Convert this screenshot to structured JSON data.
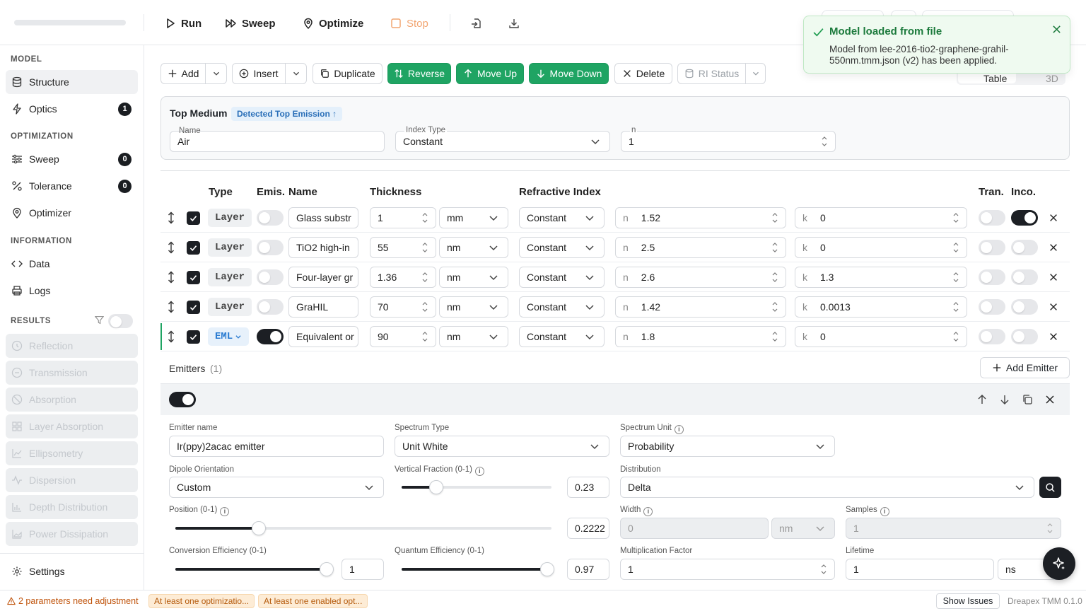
{
  "toolbar": {
    "run_label": "Run",
    "sweep_label": "Sweep",
    "optimize_label": "Optimize",
    "stop_label": "Stop"
  },
  "sidebar": {
    "model_section": "MODEL",
    "structure": "Structure",
    "optics": "Optics",
    "optics_badge": "1",
    "optimization_section": "OPTIMIZATION",
    "sweep": "Sweep",
    "sweep_badge": "0",
    "tolerance": "Tolerance",
    "tolerance_badge": "0",
    "optimizer": "Optimizer",
    "information_section": "INFORMATION",
    "data": "Data",
    "logs": "Logs",
    "results_section": "RESULTS",
    "results": [
      "Reflection",
      "Transmission",
      "Absorption",
      "Layer Absorption",
      "Ellipsometry",
      "Dispersion",
      "Depth Distribution",
      "Power Dissipation"
    ],
    "settings": "Settings"
  },
  "actions": {
    "add": "Add",
    "insert": "Insert",
    "duplicate": "Duplicate",
    "reverse": "Reverse",
    "move_up": "Move Up",
    "move_down": "Move Down",
    "delete": "Delete",
    "ri_status": "RI Status"
  },
  "view_tabs": {
    "table": "Table",
    "three_d": "3D"
  },
  "top_medium": {
    "title": "Top Medium",
    "badge": "Detected Top Emission ↑",
    "name_label": "Name",
    "name_value": "Air",
    "index_type_label": "Index Type",
    "index_type_value": "Constant",
    "n_label": "n",
    "n_value": "1"
  },
  "table": {
    "headers": {
      "type": "Type",
      "emis": "Emis.",
      "name": "Name",
      "thickness": "Thickness",
      "ri": "Refractive Index",
      "tran": "Tran.",
      "inco": "Inco."
    },
    "rows": [
      {
        "type": "Layer",
        "emissive": false,
        "name": "Glass substr",
        "thickness": "1",
        "unit": "mm",
        "index_type": "Constant",
        "n": "1.52",
        "k": "0",
        "tran": false,
        "inco": true
      },
      {
        "type": "Layer",
        "emissive": false,
        "name": "TiO2 high-in",
        "thickness": "55",
        "unit": "nm",
        "index_type": "Constant",
        "n": "2.5",
        "k": "0",
        "tran": false,
        "inco": false
      },
      {
        "type": "Layer",
        "emissive": false,
        "name": "Four-layer gr",
        "thickness": "1.36",
        "unit": "nm",
        "index_type": "Constant",
        "n": "2.6",
        "k": "1.3",
        "tran": false,
        "inco": false
      },
      {
        "type": "Layer",
        "emissive": false,
        "name": "GraHIL",
        "thickness": "70",
        "unit": "nm",
        "index_type": "Constant",
        "n": "1.42",
        "k": "0.0013",
        "tran": false,
        "inco": false
      },
      {
        "type": "EML",
        "emissive": true,
        "name": "Equivalent or",
        "thickness": "90",
        "unit": "nm",
        "index_type": "Constant",
        "n": "1.8",
        "k": "0",
        "tran": false,
        "inco": false
      }
    ],
    "n_prefix": "n",
    "k_prefix": "k"
  },
  "emitters": {
    "title": "Emitters",
    "count": "(1)",
    "add_label": "Add Emitter",
    "enabled": true,
    "name_label": "Emitter name",
    "name_value": "Ir(ppy)2acac emitter",
    "spectrum_type_label": "Spectrum Type",
    "spectrum_type_value": "Unit White",
    "spectrum_unit_label": "Spectrum Unit",
    "spectrum_unit_value": "Probability",
    "dipole_label": "Dipole Orientation",
    "dipole_value": "Custom",
    "vertical_label": "Vertical Fraction (0-1)",
    "vertical_value": "0.23",
    "vertical_fraction": 0.23,
    "distribution_label": "Distribution",
    "distribution_value": "Delta",
    "position_label": "Position (0-1)",
    "position_value": "0.2222",
    "position_fraction": 0.2222,
    "width_label": "Width",
    "width_value": "0",
    "width_unit": "nm",
    "samples_label": "Samples",
    "samples_value": "1",
    "conversion_label": "Conversion Efficiency (0-1)",
    "conversion_value": "1",
    "conversion_fraction": 1,
    "quantum_label": "Quantum Efficiency (0-1)",
    "quantum_value": "0.97",
    "quantum_fraction": 0.97,
    "multiplication_label": "Multiplication Factor",
    "multiplication_value": "1",
    "lifetime_label": "Lifetime",
    "lifetime_value": "1",
    "lifetime_unit": "ns"
  },
  "status": {
    "warning": "2 parameters need adjustment",
    "tag1": "At least one optimizatio...",
    "tag2": "At least one enabled opt...",
    "show_issues": "Show Issues",
    "version": "Dreapex TMM 0.1.0"
  },
  "toast": {
    "title": "Model loaded from file",
    "body": "Model from lee-2016-tio2-graphene-grahil-550nm.tmm.json (v2) has been applied."
  },
  "colors": {
    "accent_green": "#1fa463",
    "dark": "#1c1f24",
    "warning": "#b55a0b"
  }
}
